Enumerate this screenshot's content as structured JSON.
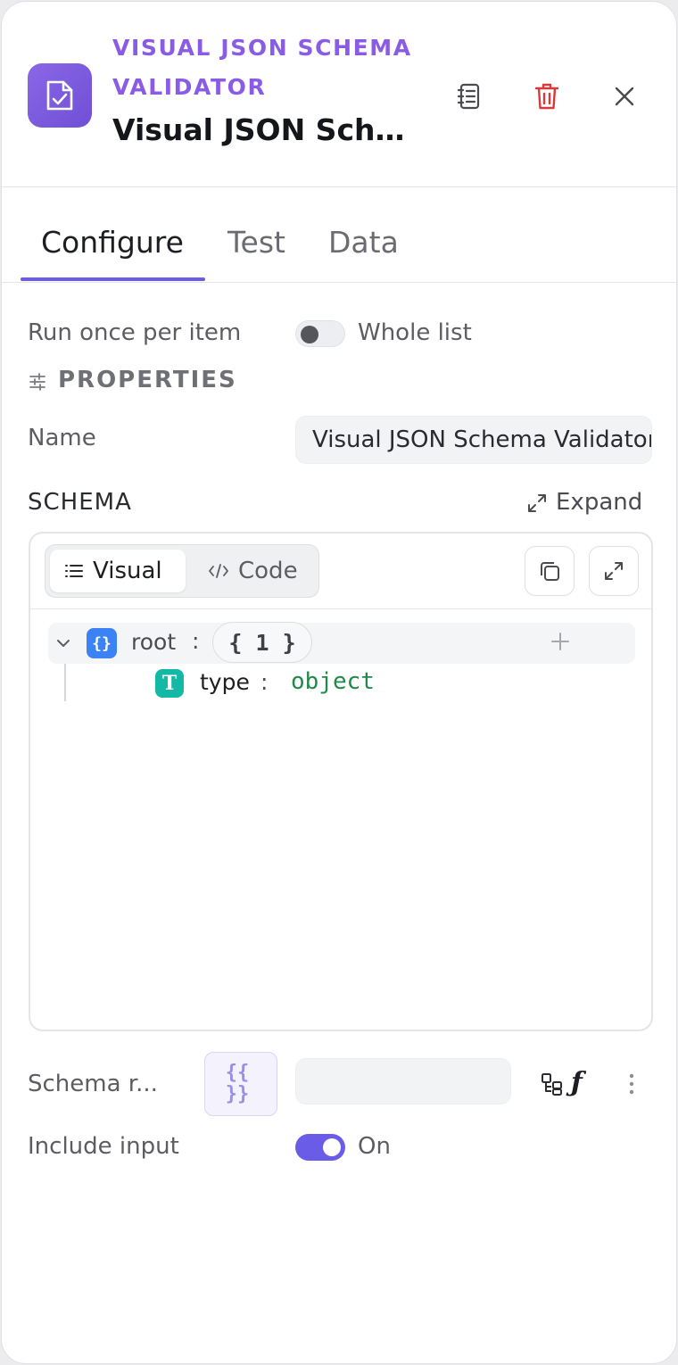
{
  "header": {
    "kicker": "VISUAL JSON SCHEMA VALIDATOR",
    "title": "Visual JSON Sch...",
    "icons": [
      "file-check-icon",
      "notes-icon",
      "trash-icon",
      "close-icon"
    ]
  },
  "tabs": [
    {
      "label": "Configure",
      "active": true
    },
    {
      "label": "Test",
      "active": false
    },
    {
      "label": "Data",
      "active": false
    }
  ],
  "run_mode": {
    "label": "Run once per item",
    "toggle_label": "Whole list",
    "on": false
  },
  "properties": {
    "heading": "PROPERTIES"
  },
  "name_field": {
    "label": "Name",
    "value": "Visual JSON Schema Validator"
  },
  "schema": {
    "heading": "SCHEMA",
    "expand_label": "Expand",
    "modes": [
      {
        "label": "Visual",
        "active": true
      },
      {
        "label": "Code",
        "active": false
      }
    ],
    "tree": {
      "root_key": "root",
      "root_count": "{ 1 }",
      "children": [
        {
          "key": "type",
          "value": "object"
        }
      ]
    }
  },
  "schema_ref": {
    "label": "Schema r...",
    "braces_top": "{{",
    "braces_bottom": "}}",
    "value": ""
  },
  "include_input": {
    "label": "Include input",
    "toggle_label": "On",
    "on": true
  },
  "colors": {
    "accent": "#6b5ce7",
    "kicker": "#8a5ce6",
    "danger": "#d83a3a",
    "json_blue": "#3b82f6",
    "type_teal": "#14b8a6",
    "value_green": "#1f8a4a"
  }
}
